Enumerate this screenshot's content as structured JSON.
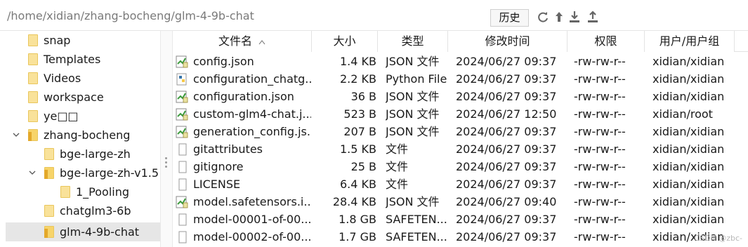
{
  "pathbar": {
    "path": "/home/xidian/zhang-bocheng/glm-4-9b-chat",
    "history_label": "历史"
  },
  "toolbar": {
    "icons": [
      "refresh-icon",
      "parent-dir-icon",
      "download-icon",
      "upload-icon"
    ]
  },
  "tree": {
    "items": [
      {
        "label": "snap",
        "indent": 0,
        "expanded": null,
        "selected": false
      },
      {
        "label": "Templates",
        "indent": 0,
        "expanded": null,
        "selected": false
      },
      {
        "label": "Videos",
        "indent": 0,
        "expanded": null,
        "selected": false
      },
      {
        "label": "workspace",
        "indent": 0,
        "expanded": null,
        "selected": false
      },
      {
        "label": "ye□□",
        "indent": 0,
        "expanded": null,
        "selected": false
      },
      {
        "label": "zhang-bocheng",
        "indent": 0,
        "expanded": true,
        "selected": false
      },
      {
        "label": "bge-large-zh",
        "indent": 1,
        "expanded": null,
        "selected": false
      },
      {
        "label": "bge-large-zh-v1.5",
        "indent": 1,
        "expanded": true,
        "selected": false
      },
      {
        "label": "1_Pooling",
        "indent": 2,
        "expanded": null,
        "selected": false
      },
      {
        "label": "chatglm3-6b",
        "indent": 1,
        "expanded": null,
        "selected": false
      },
      {
        "label": "glm-4-9b-chat",
        "indent": 1,
        "expanded": null,
        "selected": true
      }
    ]
  },
  "filelist": {
    "columns": {
      "name": "文件名",
      "size": "大小",
      "type": "类型",
      "modified": "修改时间",
      "perms": "权限",
      "owner": "用户/用户组"
    },
    "sort_indicator": "^",
    "rows": [
      {
        "name": "config.json",
        "size": "1.4 KB",
        "type": "JSON 文件",
        "modified": "2024/06/27 09:37",
        "perms": "-rw-rw-r--",
        "owner": "xidian/xidian",
        "icon": "json"
      },
      {
        "name": "configuration_chatg...",
        "size": "2.2 KB",
        "type": "Python File",
        "modified": "2024/06/27 09:37",
        "perms": "-rw-rw-r--",
        "owner": "xidian/xidian",
        "icon": "python"
      },
      {
        "name": "configuration.json",
        "size": "36 B",
        "type": "JSON 文件",
        "modified": "2024/06/27 09:37",
        "perms": "-rw-rw-r--",
        "owner": "xidian/xidian",
        "icon": "json"
      },
      {
        "name": "custom-glm4-chat.j...",
        "size": "523 B",
        "type": "JSON 文件",
        "modified": "2024/06/27 12:50",
        "perms": "-rw-rw-r--",
        "owner": "xidian/root",
        "icon": "json"
      },
      {
        "name": "generation_config.js...",
        "size": "207 B",
        "type": "JSON 文件",
        "modified": "2024/06/27 09:37",
        "perms": "-rw-rw-r--",
        "owner": "xidian/xidian",
        "icon": "json"
      },
      {
        "name": "gitattributes",
        "size": "1.5 KB",
        "type": "文件",
        "modified": "2024/06/27 09:37",
        "perms": "-rw-rw-r--",
        "owner": "xidian/xidian",
        "icon": "plain"
      },
      {
        "name": "gitignore",
        "size": "25 B",
        "type": "文件",
        "modified": "2024/06/27 09:37",
        "perms": "-rw-rw-r--",
        "owner": "xidian/xidian",
        "icon": "plain"
      },
      {
        "name": "LICENSE",
        "size": "6.4 KB",
        "type": "文件",
        "modified": "2024/06/27 09:37",
        "perms": "-rw-rw-r--",
        "owner": "xidian/xidian",
        "icon": "plain"
      },
      {
        "name": "model.safetensors.i...",
        "size": "28.4 KB",
        "type": "JSON 文件",
        "modified": "2024/06/27 09:40",
        "perms": "-rw-rw-r--",
        "owner": "xidian/xidian",
        "icon": "json"
      },
      {
        "name": "model-00001-of-00...",
        "size": "1.8 GB",
        "type": "SAFETEN...",
        "modified": "2024/06/27 09:37",
        "perms": "-rw-rw-r--",
        "owner": "xidian/xidian",
        "icon": "plain"
      },
      {
        "name": "model-00002-of-00...",
        "size": "1.7 GB",
        "type": "SAFETEN...",
        "modified": "2024/06/27 09:37",
        "perms": "-rw-rw-r--",
        "owner": "xidian/xidian",
        "icon": "plain"
      }
    ]
  },
  "watermark": "CSDN @zbc-",
  "colors": {
    "selected_bg": "#e6e6e6",
    "folder_yellow": "#f9e29a",
    "folder_open": "#e3a82a",
    "path_text": "#7a7a7a",
    "json_icon_green": "#3a9a3a",
    "python_blue": "#3775a9",
    "python_yellow": "#f7c948"
  }
}
